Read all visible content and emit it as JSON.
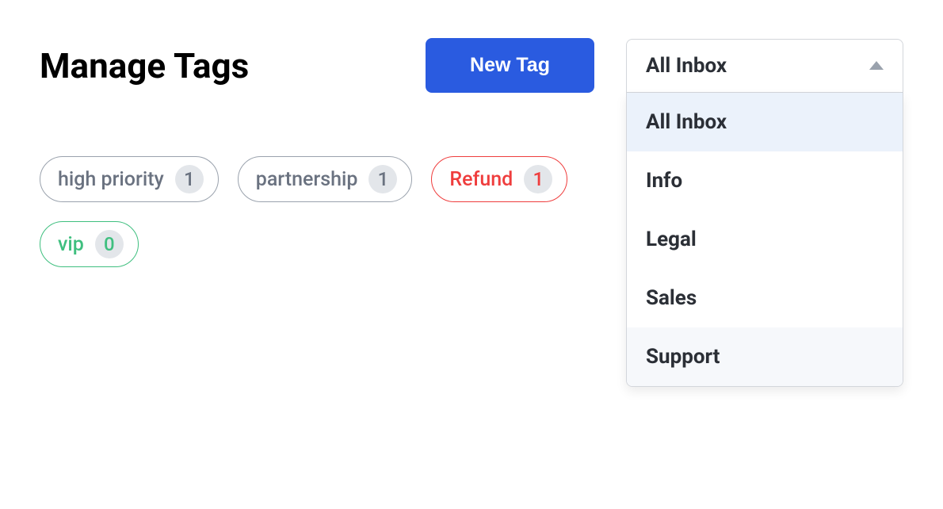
{
  "header": {
    "title": "Manage Tags",
    "new_tag_label": "New Tag"
  },
  "dropdown": {
    "selected": "All Inbox",
    "items": [
      {
        "label": "All Inbox",
        "state": "selected"
      },
      {
        "label": "Info",
        "state": ""
      },
      {
        "label": "Legal",
        "state": ""
      },
      {
        "label": "Sales",
        "state": ""
      },
      {
        "label": "Support",
        "state": "hover"
      }
    ]
  },
  "tags": [
    {
      "label": "high priority",
      "count": "1",
      "color": "gray"
    },
    {
      "label": "partnership",
      "count": "1",
      "color": "gray"
    },
    {
      "label": "Refund",
      "count": "1",
      "color": "red"
    },
    {
      "label": "vip",
      "count": "0",
      "color": "green"
    }
  ]
}
